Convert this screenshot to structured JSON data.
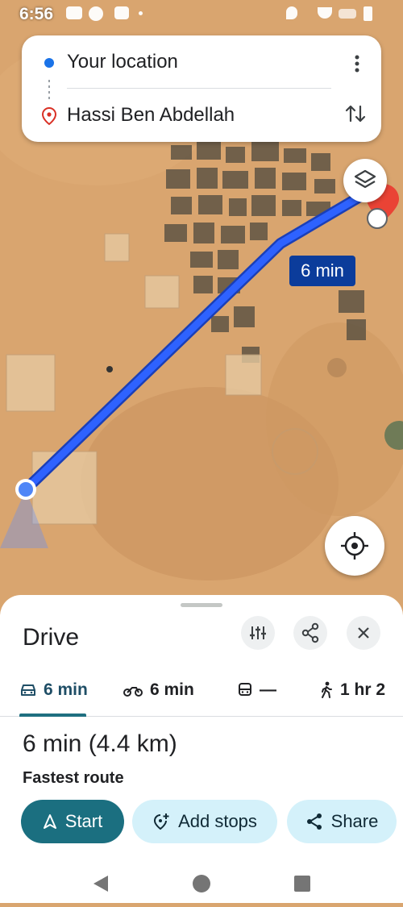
{
  "status_bar": {
    "time": "6:56"
  },
  "directions": {
    "origin": "Your location",
    "destination": "Hassi Ben Abdellah"
  },
  "map": {
    "route_duration_label": "6 min",
    "route_color": "#1e5bff"
  },
  "sheet": {
    "title": "Drive",
    "modes": [
      {
        "name": "car",
        "value": "6 min",
        "active": true
      },
      {
        "name": "motorcycle",
        "value": "6 min",
        "active": false
      },
      {
        "name": "transit",
        "value": "—",
        "active": false
      },
      {
        "name": "walk",
        "value": "1 hr 2",
        "active": false
      }
    ],
    "route_summary": "6 min (4.4 km)",
    "route_note": "Fastest route",
    "buttons": {
      "start": "Start",
      "add_stops": "Add stops",
      "share": "Share"
    }
  },
  "colors": {
    "accent": "#1b6f80",
    "route_label_bg": "#0b3c9b",
    "destination_pin": "#ea4335"
  }
}
